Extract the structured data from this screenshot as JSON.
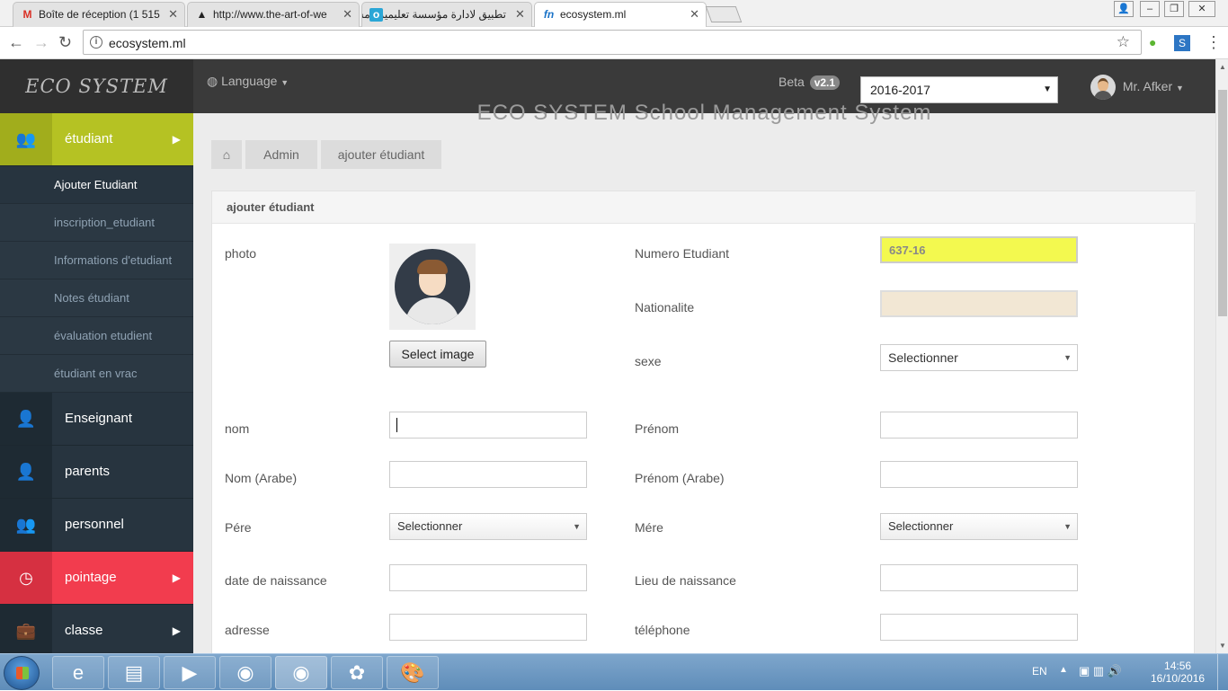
{
  "browser": {
    "tabs": [
      {
        "title": "Boîte de réception (1 515",
        "icon": "gmail-icon"
      },
      {
        "title": "http://www.the-art-of-we",
        "icon": "linux-penguin-icon"
      },
      {
        "title": "تطبيق لادارة مؤسسة تعليمية | مستقل",
        "icon": "mostaql-icon"
      },
      {
        "title": "ecosystem.ml",
        "icon": "fn-icon"
      }
    ],
    "url": "ecosystem.ml"
  },
  "app": {
    "logo": "ECO SYSTEM",
    "language": "Language",
    "beta_label": "Beta",
    "version": "v2.1",
    "year": "2016-2017",
    "user_name": "Mr. Afker",
    "bg_title": "ECO SYSTEM School Management System"
  },
  "sidebar": {
    "main_top": {
      "label": "étudiant",
      "icon": "users-icon"
    },
    "sub_items": [
      "Ajouter Etudiant",
      "inscription_etudiant",
      "Informations d'etudiant",
      "Notes étudiant",
      "évaluation etudient",
      "étudiant en vrac"
    ],
    "main_items": [
      {
        "label": "Enseignant",
        "icon": "user-icon"
      },
      {
        "label": "parents",
        "icon": "user-icon"
      },
      {
        "label": "personnel",
        "icon": "users-icon"
      },
      {
        "label": "pointage",
        "icon": "clock-icon"
      },
      {
        "label": "classe",
        "icon": "briefcase-icon"
      }
    ]
  },
  "breadcrumb": [
    "Admin",
    "ajouter étudiant"
  ],
  "form": {
    "title": "ajouter étudiant",
    "photo_label": "photo",
    "select_image": "Select image",
    "numero_label": "Numero Etudiant",
    "numero_value": "637-16",
    "nationalite_label": "Nationalite",
    "sexe_label": "sexe",
    "sexe_value": "Selectionner",
    "nom_label": "nom",
    "prenom_label": "Prénom",
    "nom_arabe_label": "Nom (Arabe)",
    "prenom_arabe_label": "Prénom (Arabe)",
    "pere_label": "Pére",
    "pere_value": "Selectionner",
    "mere_label": "Mére",
    "mere_value": "Selectionner",
    "date_label": "date de naissance",
    "lieu_label": "Lieu de naissance",
    "adresse_label": "adresse",
    "telephone_label": "téléphone"
  },
  "taskbar": {
    "lang": "EN",
    "time": "14:56",
    "date": "16/10/2016"
  }
}
